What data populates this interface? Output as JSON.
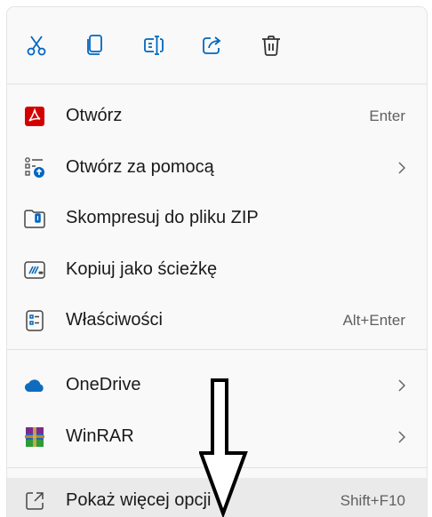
{
  "toolbar": {
    "icons": [
      "cut-icon",
      "copy-icon",
      "rename-icon",
      "share-icon",
      "delete-icon"
    ]
  },
  "menu": {
    "items": [
      {
        "label": "Otwórz",
        "shortcut": "Enter",
        "icon": "pdf-icon"
      },
      {
        "label": "Otwórz za pomocą",
        "shortcut": "",
        "icon": "open-with-icon"
      },
      {
        "label": "Skompresuj do pliku ZIP",
        "shortcut": "",
        "icon": "zip-folder-icon"
      },
      {
        "label": "Kopiuj jako ścieżkę",
        "shortcut": "",
        "icon": "copy-path-icon"
      },
      {
        "label": "Właściwości",
        "shortcut": "Alt+Enter",
        "icon": "properties-icon"
      },
      {
        "label": "OneDrive",
        "shortcut": "",
        "icon": "onedrive-icon"
      },
      {
        "label": "WinRAR",
        "shortcut": "",
        "icon": "winrar-icon"
      },
      {
        "label": "Pokaż więcej opcji",
        "shortcut": "Shift+F10",
        "icon": "more-options-icon"
      }
    ]
  },
  "colors": {
    "accent": "#0067c0",
    "pdf_red": "#d40000",
    "onedrive_blue": "#0f6cbd",
    "highlight": "#eaeaea"
  }
}
